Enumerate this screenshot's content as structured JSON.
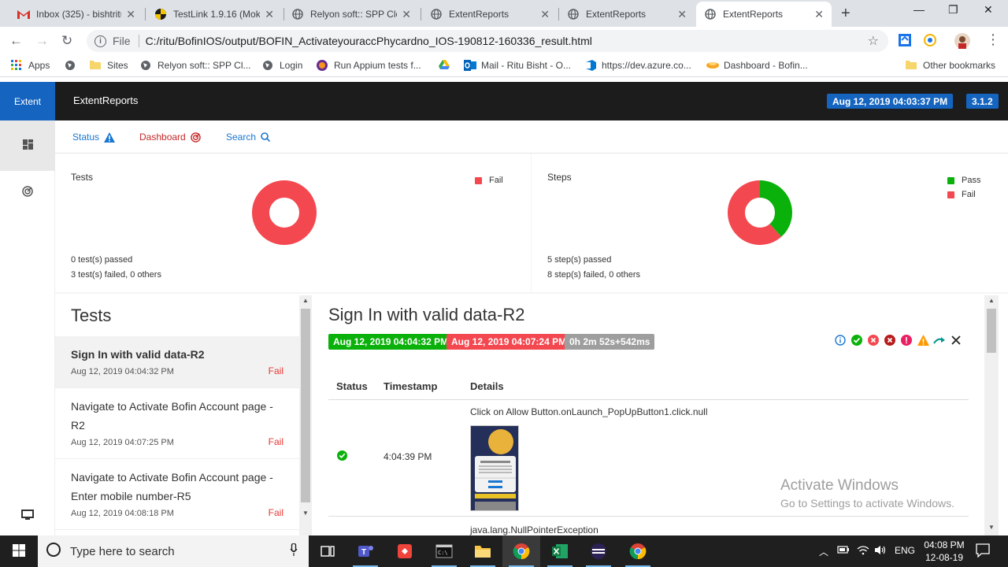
{
  "browser": {
    "tabs": [
      {
        "title": "Inbox (325) - bishtritu",
        "icon": "gmail-icon",
        "active": false
      },
      {
        "title": "TestLink 1.9.16 (Moka",
        "icon": "testlink-icon",
        "active": false
      },
      {
        "title": "Relyon soft:: SPP Clou",
        "icon": "globe-icon",
        "active": false
      },
      {
        "title": "ExtentReports",
        "icon": "globe-icon",
        "active": false
      },
      {
        "title": "ExtentReports",
        "icon": "globe-icon",
        "active": false
      },
      {
        "title": "ExtentReports",
        "icon": "globe-icon",
        "active": true
      }
    ],
    "address": {
      "protocol": "File",
      "url": "C:/ritu/BofinIOS/output/BOFIN_ActivateyouraccPhycardno_IOS-190812-160336_result.html"
    },
    "bookmarks": [
      {
        "label": "Apps",
        "icon": "apps-grid-icon"
      },
      {
        "label": "",
        "icon": "globe-icon"
      },
      {
        "label": "Sites",
        "icon": "folder-icon"
      },
      {
        "label": "Relyon soft:: SPP Cl...",
        "icon": "globe-icon"
      },
      {
        "label": "Login",
        "icon": "globe-icon"
      },
      {
        "label": "Run Appium tests f...",
        "icon": "appium-icon"
      },
      {
        "label": "",
        "icon": "drive-icon"
      },
      {
        "label": "Mail - Ritu Bisht - O...",
        "icon": "outlook-icon"
      },
      {
        "label": "https://dev.azure.co...",
        "icon": "azure-icon"
      },
      {
        "label": "Dashboard - Bofin...",
        "icon": "dashboard-icon"
      },
      {
        "label": "Other bookmarks",
        "icon": "folder-icon"
      }
    ]
  },
  "report": {
    "brand": "Extent",
    "title": "ExtentReports",
    "run_date": "Aug 12, 2019 04:03:37 PM",
    "version": "3.1.2",
    "subnav": {
      "status": "Status",
      "dashboard": "Dashboard",
      "search": "Search"
    },
    "tests_card": {
      "title": "Tests",
      "legend": [
        {
          "label": "Fail",
          "color": "#f44850"
        }
      ],
      "passed_text": "0 test(s) passed",
      "failed_text": "3 test(s) failed, 0 others",
      "chart_data": {
        "type": "pie",
        "categories": [
          "Pass",
          "Fail"
        ],
        "values": [
          0,
          3
        ]
      }
    },
    "steps_card": {
      "title": "Steps",
      "legend": [
        {
          "label": "Pass",
          "color": "#0ab10a"
        },
        {
          "label": "Fail",
          "color": "#f44850"
        }
      ],
      "passed_text": "5 step(s) passed",
      "failed_text": "8 step(s) failed, 0 others",
      "chart_data": {
        "type": "pie",
        "categories": [
          "Pass",
          "Fail"
        ],
        "values": [
          5,
          8
        ]
      }
    },
    "tests_heading": "Tests",
    "tests": [
      {
        "name": "Sign In with valid data-R2",
        "time": "Aug 12, 2019 04:04:32 PM",
        "status": "Fail"
      },
      {
        "name": "Navigate to Activate Bofin Account page -R2",
        "time": "Aug 12, 2019 04:07:25 PM",
        "status": "Fail"
      },
      {
        "name": "Navigate to Activate Bofin Account page - Enter mobile number-R5",
        "time": "Aug 12, 2019 04:08:18 PM",
        "status": "Fail"
      }
    ],
    "detail": {
      "title": "Sign In with valid data-R2",
      "start": "Aug 12, 2019 04:04:32 PM",
      "end": "Aug 12, 2019 04:07:24 PM",
      "duration": "0h 2m 52s+542ms",
      "columns": {
        "status": "Status",
        "timestamp": "Timestamp",
        "details": "Details"
      },
      "rows": [
        {
          "status": "pass",
          "timestamp": "4:04:39 PM",
          "details": "Click on Allow Button.onLaunch_PopUpButton1.click.null"
        },
        {
          "status": "fail",
          "timestamp": "",
          "details": "java.lang.NullPointerException"
        }
      ]
    },
    "watermark": {
      "line1": "Activate Windows",
      "line2": "Go to Settings to activate Windows."
    }
  },
  "taskbar": {
    "search_placeholder": "Type here to search",
    "lang": "ENG",
    "time": "04:08 PM",
    "date": "12-08-19"
  }
}
